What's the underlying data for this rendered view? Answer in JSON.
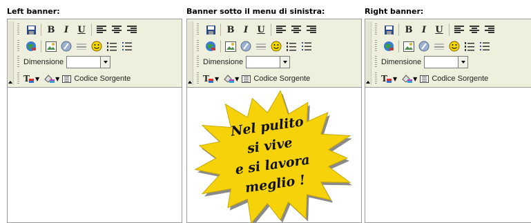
{
  "columns": [
    {
      "title": "Left banner:",
      "has_image": false
    },
    {
      "title": "Banner sotto il menu di sinistra:",
      "has_image": true
    },
    {
      "title": "Right banner:",
      "has_image": false
    }
  ],
  "toolbar": {
    "bold": "B",
    "italic": "I",
    "underline": "U",
    "size_label": "Dimensione",
    "size_value": "",
    "source_label": "Codice Sorgente",
    "text_color_glyph": "T"
  },
  "banner_image": {
    "lines": [
      "Nel pulito",
      "si vive",
      "e si lavora",
      "meglio !"
    ],
    "fill_color": "#f5d20a",
    "shadow_color": "#8a8a8a",
    "text_color": "#111111"
  }
}
